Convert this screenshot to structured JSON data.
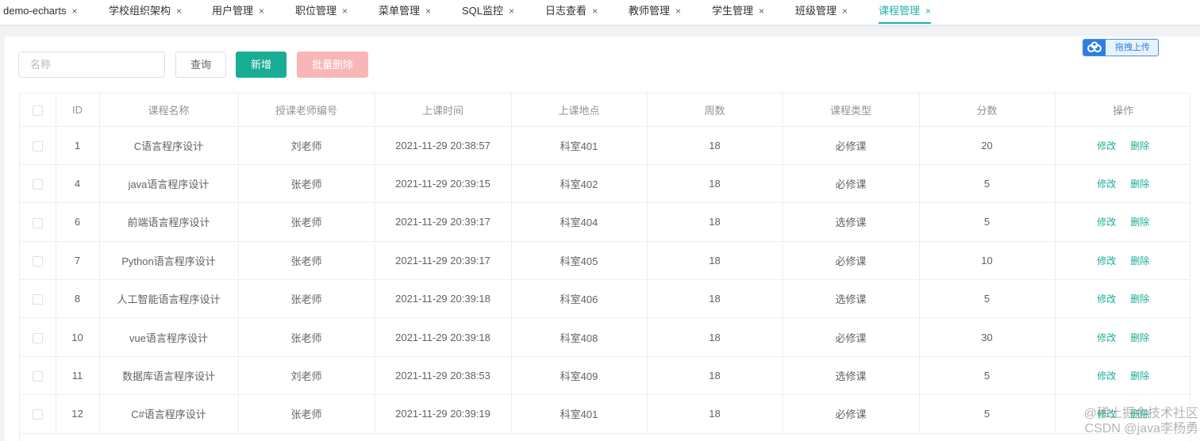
{
  "tabs": [
    {
      "label": "demo-echarts",
      "close": "×"
    },
    {
      "label": "学校组织架构",
      "close": "×"
    },
    {
      "label": "用户管理",
      "close": "×"
    },
    {
      "label": "职位管理",
      "close": "×"
    },
    {
      "label": "菜单管理",
      "close": "×"
    },
    {
      "label": "SQL监控",
      "close": "×"
    },
    {
      "label": "日志查看",
      "close": "×"
    },
    {
      "label": "教师管理",
      "close": "×"
    },
    {
      "label": "学生管理",
      "close": "×"
    },
    {
      "label": "班级管理",
      "close": "×"
    },
    {
      "label": "课程管理",
      "close": "×",
      "active": true
    }
  ],
  "toolbar": {
    "search_placeholder": "名称",
    "search_value": "",
    "query_label": "查询",
    "add_label": "新增",
    "batch_delete_label": "批量删除"
  },
  "upload": {
    "label": "拖拽上传",
    "icon": "cloud-upload-icon"
  },
  "table": {
    "columns": [
      "",
      "ID",
      "课程名称",
      "授课老师编号",
      "上课时间",
      "上课地点",
      "周数",
      "课程类型",
      "分数",
      "操作"
    ],
    "rows": [
      {
        "id": "1",
        "name": "C语言程序设计",
        "teacher": "刘老师",
        "time": "2021-11-29 20:38:57",
        "place": "科室401",
        "weeks": "18",
        "type": "必修课",
        "score": "20"
      },
      {
        "id": "4",
        "name": "java语言程序设计",
        "teacher": "张老师",
        "time": "2021-11-29 20:39:15",
        "place": "科室402",
        "weeks": "18",
        "type": "必修课",
        "score": "5"
      },
      {
        "id": "6",
        "name": "前端语言程序设计",
        "teacher": "张老师",
        "time": "2021-11-29 20:39:17",
        "place": "科室404",
        "weeks": "18",
        "type": "选修课",
        "score": "5"
      },
      {
        "id": "7",
        "name": "Python语言程序设计",
        "teacher": "张老师",
        "time": "2021-11-29 20:39:17",
        "place": "科室405",
        "weeks": "18",
        "type": "必修课",
        "score": "10"
      },
      {
        "id": "8",
        "name": "人工智能语言程序设计",
        "teacher": "张老师",
        "time": "2021-11-29 20:39:18",
        "place": "科室406",
        "weeks": "18",
        "type": "选修课",
        "score": "5"
      },
      {
        "id": "10",
        "name": "vue语言程序设计",
        "teacher": "张老师",
        "time": "2021-11-29 20:39:18",
        "place": "科室408",
        "weeks": "18",
        "type": "必修课",
        "score": "30"
      },
      {
        "id": "11",
        "name": "数据库语言程序设计",
        "teacher": "刘老师",
        "time": "2021-11-29 20:38:53",
        "place": "科室409",
        "weeks": "18",
        "type": "选修课",
        "score": "5"
      },
      {
        "id": "12",
        "name": "C#语言程序设计",
        "teacher": "张老师",
        "time": "2021-11-29 20:39:19",
        "place": "科室401",
        "weeks": "18",
        "type": "必修课",
        "score": "5"
      }
    ],
    "edit_label": "修改",
    "delete_label": "删除"
  },
  "watermark": {
    "line1": "@稀土掘金技术社区",
    "line2": "CSDN @java李杨勇"
  },
  "colors": {
    "accent": "#1aad96",
    "danger_light": "#f9b6b6",
    "upload_blue": "#2d7ee0"
  }
}
